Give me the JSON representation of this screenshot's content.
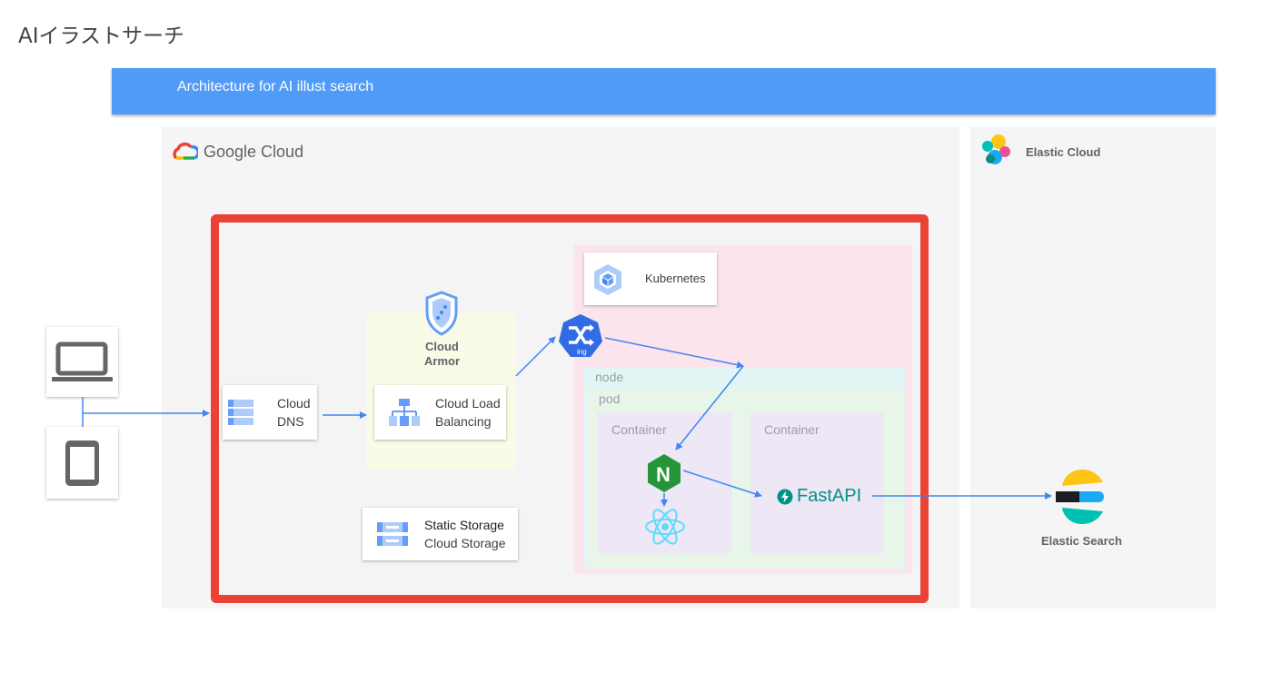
{
  "page_title": "AIイラストサーチ",
  "banner": {
    "title": "Architecture for AI illust search"
  },
  "google_cloud": {
    "logo_text": "Google Cloud"
  },
  "elastic_cloud": {
    "logo_text": "Elastic Cloud"
  },
  "nodes": {
    "cloud_dns": {
      "line1": "Cloud",
      "line2": "DNS"
    },
    "cloud_armor": {
      "line1": "Cloud",
      "line2": "Armor"
    },
    "cloud_load_balancing": {
      "line1": "Cloud Load",
      "line2": "Balancing"
    },
    "kubernetes": {
      "label": "Kubernetes"
    },
    "ingress": {
      "label": "ing"
    },
    "node_zone": {
      "label": "node"
    },
    "pod_zone": {
      "label": "pod"
    },
    "container_1": {
      "label": "Container"
    },
    "container_2": {
      "label": "Container"
    },
    "nginx": {
      "label": "N"
    },
    "fastapi": {
      "label": "FastAPI"
    },
    "static_storage": {
      "line1": "Static Storage",
      "line2": "Cloud Storage"
    },
    "elastic_search": {
      "label": "Elastic Search"
    }
  },
  "colors": {
    "banner": "#4f9bf7",
    "highlight_border": "#ea4335",
    "arrow": "#4285f4",
    "armor_zone": "#f9fbe7",
    "kubernetes_zone": "#fce4ec",
    "node_zone": "#e1f5f5",
    "pod_zone": "#e8f5e9",
    "container_zone": "#ede7f6",
    "fastapi": "#009485",
    "nginx": "#269539"
  },
  "icons": [
    "laptop-icon",
    "tablet-icon",
    "cloud-dns-icon",
    "cloud-armor-icon",
    "cloud-load-balancing-icon",
    "kubernetes-icon",
    "ingress-icon",
    "nginx-icon",
    "react-icon",
    "fastapi-icon",
    "cloud-storage-icon",
    "elastic-search-icon",
    "google-cloud-logo-icon",
    "elastic-cloud-logo-icon"
  ]
}
